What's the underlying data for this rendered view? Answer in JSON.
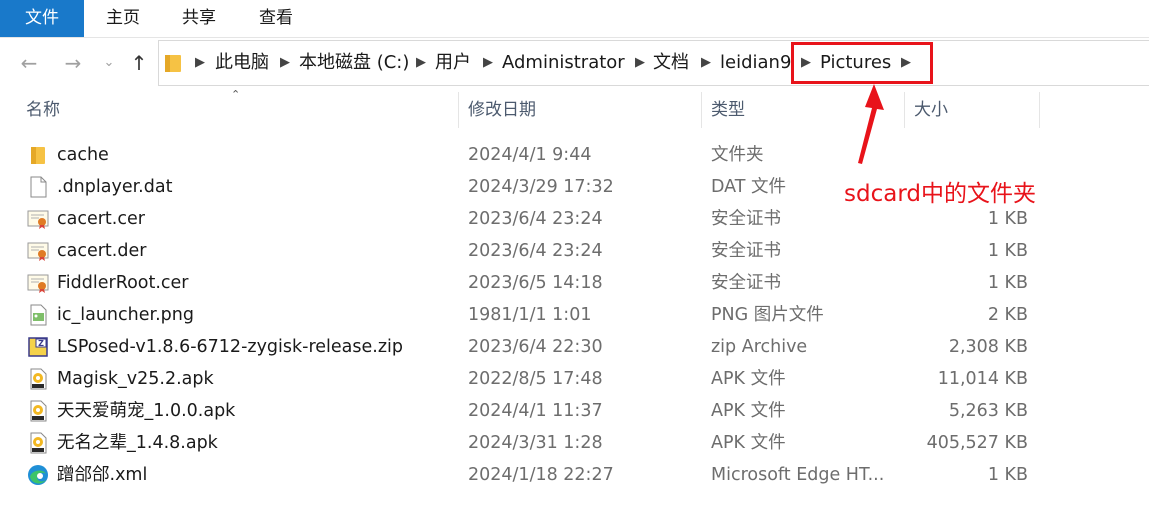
{
  "ribbon": {
    "tabs": [
      {
        "label": "文件"
      },
      {
        "label": "主页"
      },
      {
        "label": "共享"
      },
      {
        "label": "查看"
      }
    ]
  },
  "nav": {
    "back_icon": "arrow-left-icon",
    "forward_icon": "arrow-right-icon",
    "recent_icon": "chevron-down-icon",
    "up_icon": "arrow-up-icon"
  },
  "breadcrumb": [
    {
      "label": "此电脑"
    },
    {
      "label": "本地磁盘 (C:)"
    },
    {
      "label": "用户"
    },
    {
      "label": "Administrator"
    },
    {
      "label": "文档"
    },
    {
      "label": "leidian9"
    },
    {
      "label": "Pictures"
    }
  ],
  "columns": {
    "name": "名称",
    "date": "修改日期",
    "type": "类型",
    "size": "大小"
  },
  "files": [
    {
      "name": "cache",
      "date": "2024/4/1 9:44",
      "type": "文件夹",
      "size": "",
      "icon": "folder-icon"
    },
    {
      "name": ".dnplayer.dat",
      "date": "2024/3/29 17:32",
      "type": "DAT 文件",
      "size": "",
      "icon": "file-icon"
    },
    {
      "name": "cacert.cer",
      "date": "2023/6/4 23:24",
      "type": "安全证书",
      "size": "1 KB",
      "icon": "certificate-icon"
    },
    {
      "name": "cacert.der",
      "date": "2023/6/4 23:24",
      "type": "安全证书",
      "size": "1 KB",
      "icon": "certificate-icon"
    },
    {
      "name": "FiddlerRoot.cer",
      "date": "2023/6/5 14:18",
      "type": "安全证书",
      "size": "1 KB",
      "icon": "certificate-icon"
    },
    {
      "name": "ic_launcher.png",
      "date": "1981/1/1 1:01",
      "type": "PNG 图片文件",
      "size": "2 KB",
      "icon": "png-file-icon"
    },
    {
      "name": "LSPosed-v1.8.6-6712-zygisk-release.zip",
      "date": "2023/6/4 22:30",
      "type": "zip Archive",
      "size": "2,308 KB",
      "icon": "zip-archive-icon"
    },
    {
      "name": "Magisk_v25.2.apk",
      "date": "2022/8/5 17:48",
      "type": "APK 文件",
      "size": "11,014 KB",
      "icon": "apk-icon"
    },
    {
      "name": "天天爱萌宠_1.0.0.apk",
      "date": "2024/4/1 11:37",
      "type": "APK 文件",
      "size": "5,263 KB",
      "icon": "apk-icon"
    },
    {
      "name": "无名之辈_1.4.8.apk",
      "date": "2024/3/31 1:28",
      "type": "APK 文件",
      "size": "405,527 KB",
      "icon": "apk-icon"
    },
    {
      "name": "蹭郃郃.xml",
      "date": "2024/1/18 22:27",
      "type": "Microsoft Edge HT...",
      "size": "1 KB",
      "icon": "edge-icon"
    }
  ],
  "annotation": {
    "text": "sdcard中的文件夹",
    "color": "#e8131a"
  },
  "colors": {
    "accent": "#1979ca",
    "folder": "#f6c244",
    "annotation": "#e8131a"
  }
}
